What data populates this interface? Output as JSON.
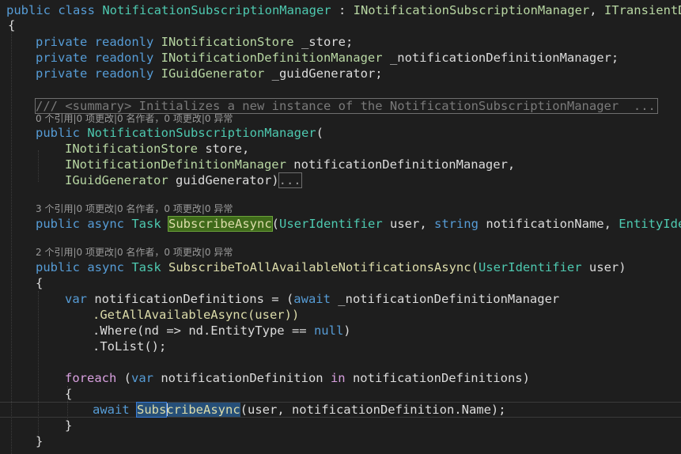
{
  "lens": {
    "ctor": "0 个引用|0 项更改|0 名作者，0 项更改|0 异常",
    "subscribe": "3 个引用|0 项更改|0 名作者，0 项更改|0 异常",
    "subscribe_all": "2 个引用|0 项更改|0 名作者，0 项更改|0 异常"
  },
  "code": {
    "l1": {
      "a": "public class ",
      "b": "NotificationSubscriptionManager",
      "c": " : ",
      "d": "INotificationSubscriptionManager",
      "e": ", ",
      "f": "ITransientDepe"
    },
    "l2": "{",
    "f1": {
      "a": "private readonly ",
      "b": "INotificationStore",
      "c": " _store;"
    },
    "f2": {
      "a": "private readonly ",
      "b": "INotificationDefinitionManager",
      "c": " _notificationDefinitionManager;"
    },
    "f3": {
      "a": "private readonly ",
      "b": "IGuidGenerator",
      "c": " _guidGenerator;"
    },
    "summary": "/// <summary> Initializes a new instance of the NotificationSubscriptionManager  ...",
    "c1": {
      "a": "public ",
      "b": "NotificationSubscriptionManager",
      "c": "("
    },
    "c2": {
      "a": "INotificationStore",
      "b": " store,"
    },
    "c3": {
      "a": "INotificationDefinitionManager",
      "b": " notificationDefinitionManager,"
    },
    "c4": {
      "a": "IGuidGenerator",
      "b": " guidGenerator)",
      "c": "..."
    },
    "s1": {
      "a": "public async ",
      "b": "Task",
      "c": " ",
      "d": "SubscribeAsync",
      "e": "(",
      "f": "UserIdentifier",
      "g": " user, ",
      "h": "string",
      "i": " notificationName, ",
      "j": "EntityIdenti"
    },
    "a1": {
      "a": "public async ",
      "b": "Task",
      "c": " SubscribeToAllAvailableNotificationsAsync(",
      "d": "UserIdentifier",
      "e": " user)"
    },
    "a2": "{",
    "a3": {
      "a": "var",
      "b": " notificationDefinitions = (",
      "c": "await",
      "d": " _notificationDefinitionManager"
    },
    "a4": ".GetAllAvailableAsync(user))",
    "a5": {
      "a": ".Where(nd => nd.EntityType == ",
      "b": "null",
      "c": ")"
    },
    "a6": ".ToList();",
    "a7": {
      "a": "foreach",
      "b": " (",
      "c": "var",
      "d": " notificationDefinition ",
      "e": "in",
      "f": " notificationDefinitions)"
    },
    "a8": "{",
    "a9": {
      "a": "await ",
      "b": "Subs",
      "c": "cribeAsync",
      "d": "(user, notificationDefinition.Name);"
    },
    "a10": "}",
    "a11": "}"
  }
}
